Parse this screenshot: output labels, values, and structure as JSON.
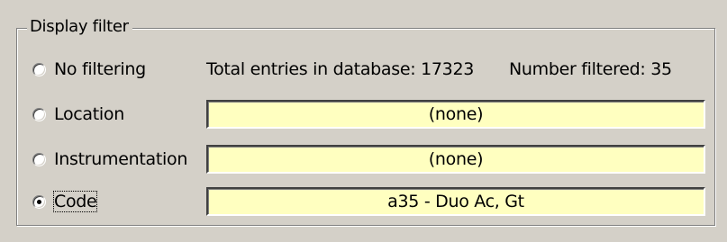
{
  "group": {
    "title": "Display filter"
  },
  "options": [
    {
      "id": "no-filtering",
      "label": "No filtering",
      "selected": false
    },
    {
      "id": "location",
      "label": "Location",
      "selected": false
    },
    {
      "id": "instrumentation",
      "label": "Instrumentation",
      "selected": false
    },
    {
      "id": "code",
      "label": "Code",
      "selected": true,
      "focused": true
    }
  ],
  "stats": {
    "total_entries": "Total entries in database: 17323",
    "number_filtered": "Number filtered: 35"
  },
  "fields": {
    "location_value": "(none)",
    "instrumentation_value": "(none)",
    "code_value": "a35 - Duo Ac, Gt"
  },
  "colors": {
    "dialog_background": "#d4d0c8",
    "field_background": "#ffffc0"
  }
}
